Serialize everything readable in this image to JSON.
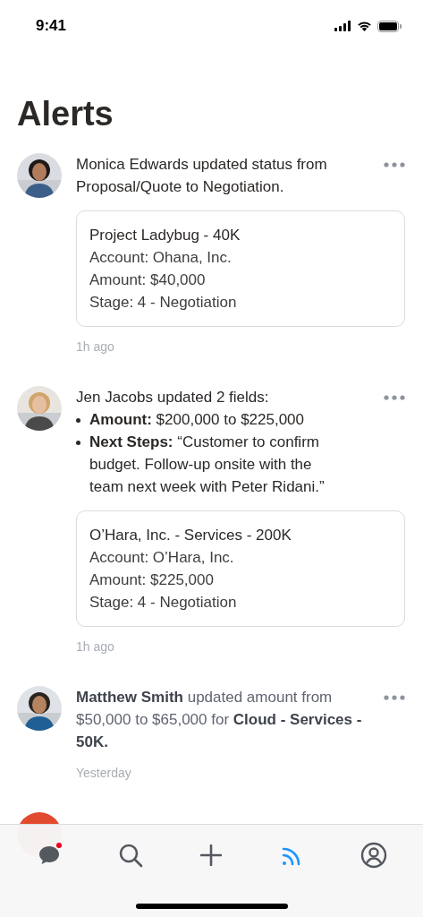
{
  "status_bar": {
    "time": "9:41"
  },
  "title": "Alerts",
  "alerts": [
    {
      "avatar": {
        "kind": "picture"
      },
      "read": false,
      "message": "Monica Edwards updated status from Proposal/Quote to Negotiation.",
      "record": {
        "title": "Project Ladybug - 40K",
        "lines": [
          "Account: Ohana, Inc.",
          "Amount: $40,000",
          "Stage: 4 - Negotiation"
        ]
      },
      "time": "1h ago"
    },
    {
      "avatar": {
        "kind": "picture"
      },
      "read": false,
      "message": "Jen Jacobs updated 2 fields:",
      "bullets": [
        "**Amount:** $200,000 to $225,000",
        "**Next Steps:** “Customer to confirm budget. Follow-up onsite with the team next week with Peter Ridani.”"
      ],
      "record": {
        "title": "O’Hara, Inc. - Services - 200K",
        "lines": [
          "Account: O’Hara, Inc.",
          "Amount: $225,000",
          "Stage: 4 - Negotiation"
        ]
      },
      "time": "1h ago"
    },
    {
      "avatar": {
        "kind": "picture"
      },
      "read": true,
      "message": "**Matthew Smith** updated amount from $50,000 to $65,000 for **Cloud - Services - 50K.**",
      "time": "Yesterday"
    }
  ],
  "tab_bar": [
    {
      "kind": "chat",
      "selected": false,
      "badge": true
    },
    {
      "kind": "search",
      "selected": false,
      "badge": false
    },
    {
      "kind": "add",
      "selected": false,
      "badge": false
    },
    {
      "kind": "feed",
      "selected": true,
      "badge": false
    },
    {
      "kind": "profile",
      "selected": false,
      "badge": false
    }
  ]
}
